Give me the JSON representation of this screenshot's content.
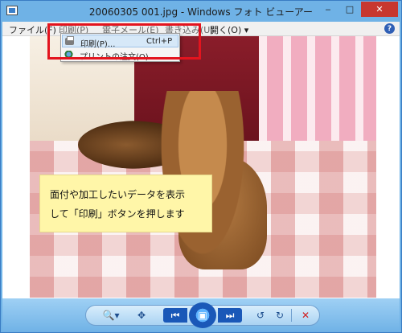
{
  "window": {
    "title": "20060305 001.jpg - Windows フォト ビューアー",
    "controls": {
      "minimize": "‒",
      "maximize": "□",
      "close": "✕"
    }
  },
  "menu": {
    "file": "ファイル(F)",
    "print": "印刷(P)",
    "email": "電子メール(E)",
    "burn": "書き込み(U)",
    "open": "開く(O) ▾",
    "help_icon": "?"
  },
  "dropdown": {
    "items": [
      {
        "label": "印刷(P)...",
        "shortcut": "Ctrl+P",
        "icon": "printer-icon"
      },
      {
        "label": "プリントの注文(O)",
        "shortcut": "",
        "icon": "globe-icon"
      }
    ]
  },
  "caption": {
    "line1": "面付や加工したいデータを表示",
    "line2": "して「印刷」ボタンを押します"
  },
  "toolbar": {
    "zoom": "🔍▾",
    "fit": "✥",
    "prev": "⏮",
    "slideshow": "▣",
    "next": "⏭",
    "rotate_left": "↺",
    "rotate_right": "↻",
    "delete": "✕"
  },
  "colors": {
    "title_bar": "#6fb2e6",
    "highlight": "#e3141e",
    "caption_bg": "#fff6a8"
  }
}
